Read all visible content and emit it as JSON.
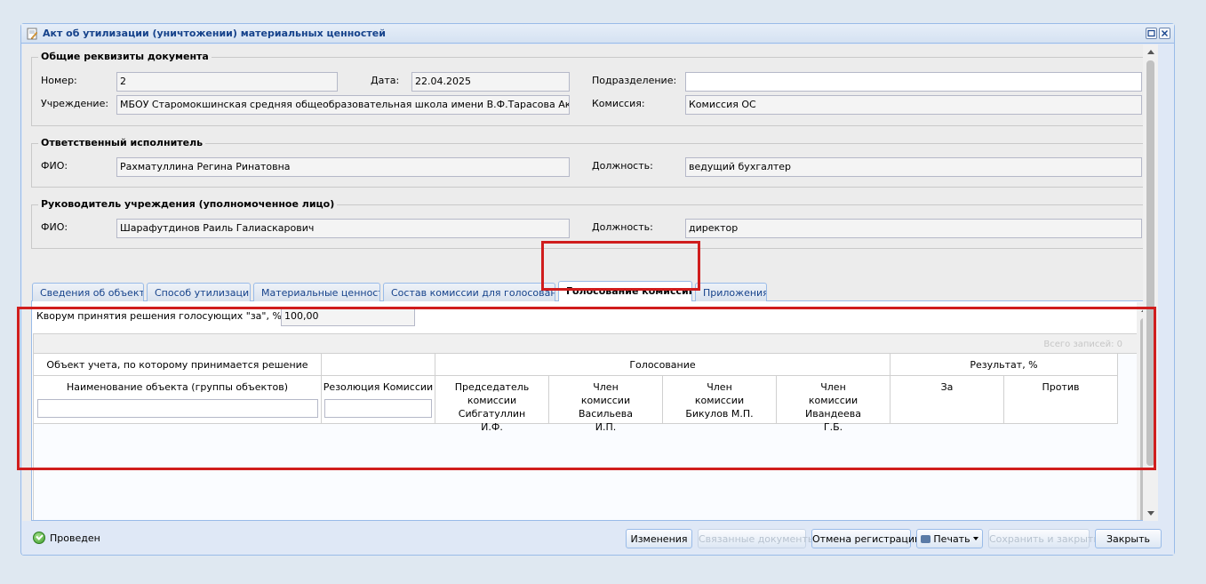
{
  "window": {
    "title": "Акт об утилизации (уничтожении) материальных ценностей"
  },
  "general": {
    "legend": "Общие реквизиты документа",
    "number_label": "Номер:",
    "number_value": "2",
    "date_label": "Дата:",
    "date_value": "22.04.2025",
    "subdivision_label": "Подразделение:",
    "subdivision_value": "",
    "institution_label": "Учреждение:",
    "institution_value": "МБОУ Старомокшинская средняя общеобразовательная школа имени В.Ф.Тарасова Аксуб",
    "commission_label": "Комиссия:",
    "commission_value": "Комиссия ОС"
  },
  "executor": {
    "legend": "Ответственный исполнитель",
    "fio_label": "ФИО:",
    "fio_value": "Рахматуллина Регина Ринатовна",
    "position_label": "Должность:",
    "position_value": "ведущий бухгалтер"
  },
  "head": {
    "legend": "Руководитель учреждения (уполномоченное лицо)",
    "fio_label": "ФИО:",
    "fio_value": "Шарафутдинов Раиль Галиаскарович",
    "position_label": "Должность:",
    "position_value": "директор"
  },
  "tabs": [
    {
      "label": "Сведения об объекте"
    },
    {
      "label": "Способ утилизации"
    },
    {
      "label": "Материальные ценности"
    },
    {
      "label": "Состав комиссии для голосования"
    },
    {
      "label": "Голосование комиссии"
    },
    {
      "label": "Приложения"
    }
  ],
  "voting": {
    "quorum_label": "Кворум принятия решения голосующих \"за\", %:",
    "quorum_value": "100,00",
    "records_text": "Всего записей: 0",
    "group_object": "Объект учета, по которому принимается решение",
    "group_voting": "Голосование",
    "group_result": "Результат, %",
    "col_object_name": "Наименование объекта (группы объектов)",
    "col_resolution": "Резолюция Комиссии",
    "col_chair": "Председатель комиссии Сибгатуллин И.Ф.",
    "col_member1": "Член комиссии Васильева И.П.",
    "col_member2": "Член комиссии Бикулов М.П.",
    "col_member3": "Член комиссии Ивандеева Г.Б.",
    "col_for": "За",
    "col_against": "Против"
  },
  "footer": {
    "status": "Проведен",
    "btn_changes": "Изменения",
    "btn_related": "Связанные документы",
    "btn_cancel_reg": "Отмена регистрации",
    "btn_print": "Печать",
    "btn_save_close": "Сохранить и закрыть",
    "btn_close": "Закрыть"
  },
  "colors": {
    "highlight": "#d01d1d",
    "accent": "#15428b",
    "status_ok": "#3b9a2a"
  }
}
